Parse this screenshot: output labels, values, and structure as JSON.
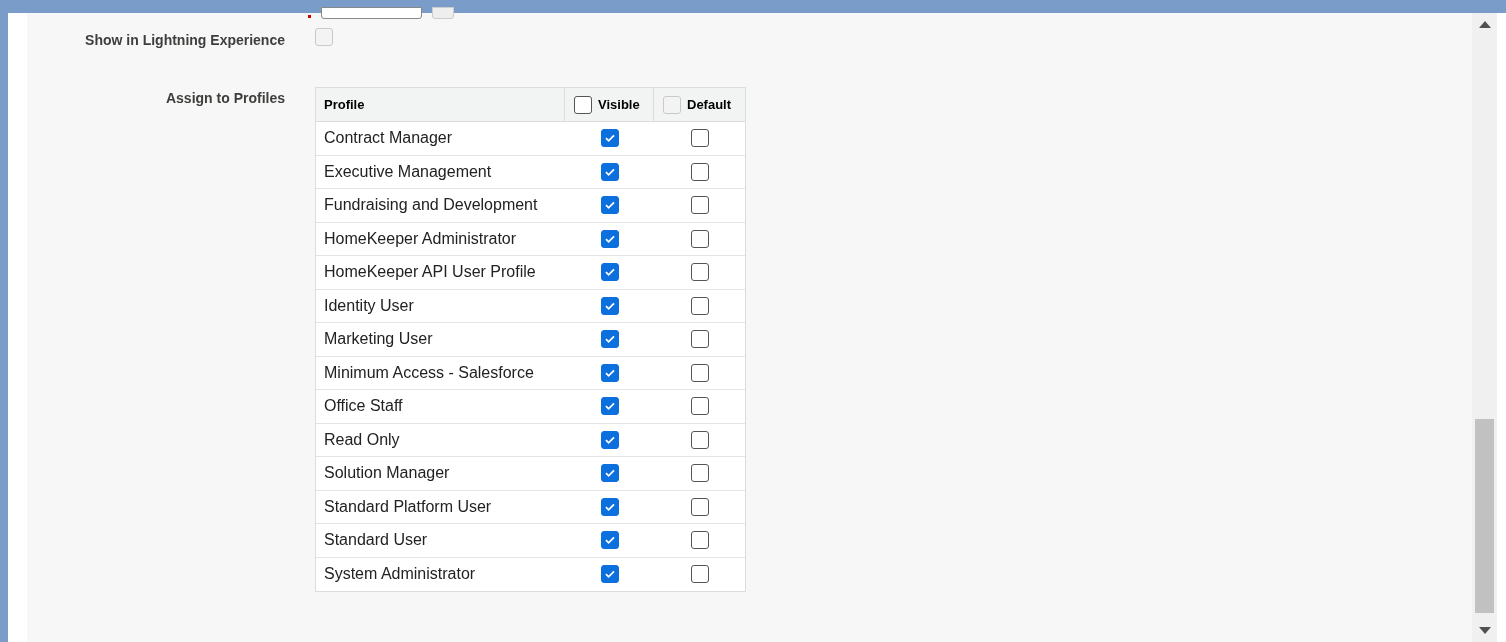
{
  "fields": [
    {
      "label": "Show in Lightning Experience",
      "checked": false,
      "disabled": true
    }
  ],
  "assign": {
    "label": "Assign to Profiles",
    "columns": [
      {
        "label": "Profile"
      },
      {
        "label": "Visible",
        "checked": false,
        "disabled": false
      },
      {
        "label": "Default",
        "checked": false,
        "disabled": true
      }
    ],
    "rows": [
      {
        "profile": "Contract Manager",
        "visible": true,
        "default": false
      },
      {
        "profile": "Executive Management",
        "visible": true,
        "default": false
      },
      {
        "profile": "Fundraising and Development",
        "visible": true,
        "default": false
      },
      {
        "profile": "HomeKeeper Administrator",
        "visible": true,
        "default": false
      },
      {
        "profile": "HomeKeeper API User Profile",
        "visible": true,
        "default": false
      },
      {
        "profile": "Identity User",
        "visible": true,
        "default": false
      },
      {
        "profile": "Marketing User",
        "visible": true,
        "default": false
      },
      {
        "profile": "Minimum Access - Salesforce",
        "visible": true,
        "default": false
      },
      {
        "profile": "Office Staff",
        "visible": true,
        "default": false
      },
      {
        "profile": "Read Only",
        "visible": true,
        "default": false
      },
      {
        "profile": "Solution Manager",
        "visible": true,
        "default": false
      },
      {
        "profile": "Standard Platform User",
        "visible": true,
        "default": false
      },
      {
        "profile": "Standard User",
        "visible": true,
        "default": false
      },
      {
        "profile": "System Administrator",
        "visible": true,
        "default": false
      }
    ]
  }
}
